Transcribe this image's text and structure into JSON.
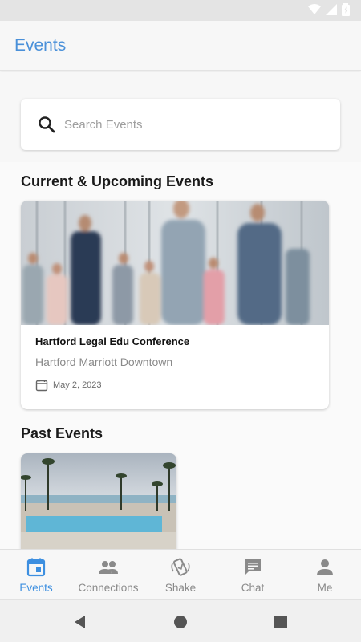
{
  "app": {
    "title": "Events"
  },
  "search": {
    "placeholder": "Search Events"
  },
  "sections": {
    "current_title": "Current & Upcoming Events",
    "past_title": "Past Events"
  },
  "current_events": [
    {
      "name": "Hartford Legal Edu Conference",
      "venue": "Hartford Marriott Downtown",
      "date": "May  2, 2023"
    }
  ],
  "bottom_nav": {
    "items": [
      {
        "label": "Events",
        "icon": "calendar-icon",
        "active": true
      },
      {
        "label": "Connections",
        "icon": "people-icon",
        "active": false
      },
      {
        "label": "Shake",
        "icon": "shake-phone-icon",
        "active": false
      },
      {
        "label": "Chat",
        "icon": "chat-icon",
        "active": false
      },
      {
        "label": "Me",
        "icon": "person-icon",
        "active": false
      }
    ]
  },
  "colors": {
    "accent": "#4a90d9",
    "active_nav": "#3d8fe0",
    "inactive_nav": "#8a8a8a"
  }
}
